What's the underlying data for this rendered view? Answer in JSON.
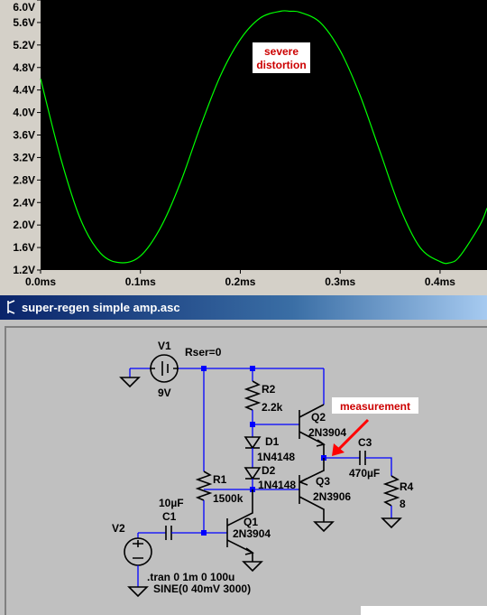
{
  "plot": {
    "y_ticks": [
      "6.0V",
      "5.6V",
      "5.2V",
      "4.8V",
      "4.4V",
      "4.0V",
      "3.6V",
      "3.2V",
      "2.8V",
      "2.4V",
      "2.0V",
      "1.6V",
      "1.2V"
    ],
    "x_ticks": [
      "0.0ms",
      "0.1ms",
      "0.2ms",
      "0.3ms",
      "0.4ms"
    ],
    "annotation": [
      "severe",
      "distortion"
    ],
    "colors": {
      "background": "#000000",
      "trace": "#00ff00",
      "annotation_text": "#cc0000"
    }
  },
  "chart_data": {
    "type": "line",
    "ylim": [
      1.2,
      6.0
    ],
    "xlim": [
      0.0,
      0.447
    ],
    "x_unit": "ms",
    "y_unit": "V",
    "x": [
      0.0,
      0.02,
      0.04,
      0.06,
      0.08,
      0.1,
      0.12,
      0.14,
      0.16,
      0.18,
      0.2,
      0.22,
      0.24,
      0.25,
      0.26,
      0.28,
      0.3,
      0.32,
      0.34,
      0.36,
      0.38,
      0.4,
      0.41,
      0.42,
      0.44,
      0.447
    ],
    "y": [
      4.6,
      3.2,
      2.1,
      1.5,
      1.33,
      1.45,
      1.95,
      2.75,
      3.75,
      4.65,
      5.3,
      5.68,
      5.8,
      5.8,
      5.78,
      5.6,
      5.1,
      4.3,
      3.3,
      2.3,
      1.6,
      1.35,
      1.33,
      1.45,
      2.0,
      2.3
    ]
  },
  "window": {
    "title": "super-regen simple amp.asc",
    "title_colors": {
      "start": "#0a246a",
      "end": "#a6caf0"
    }
  },
  "schematic": {
    "labels": {
      "v1": "V1",
      "v1_value": "9V",
      "rser": "Rser=0",
      "r2": "R2",
      "r2_value": "2.2k",
      "q2": "Q2",
      "q2_value": "2N3904",
      "measurement": "measurement",
      "d1": "D1",
      "d1_value": "1N4148",
      "d2": "D2",
      "d2_value": "1N4148",
      "q3": "Q3",
      "q3_value": "2N3906",
      "c3": "C3",
      "c3_value": "470µF",
      "r1": "R1",
      "r1_value": "1500k",
      "r4": "R4",
      "r4_value": "8",
      "c1_value": "10µF",
      "c1": "C1",
      "q1": "Q1",
      "q1_value": "2N3904",
      "v2": "V2",
      "tran": ".tran 0 1m 0 100u",
      "sine": "SINE(0 40mV 3000)"
    },
    "colors": {
      "wire": "#0000ff",
      "part": "#000000",
      "arrow": "#ff0000",
      "label_box": "#ffffff"
    }
  }
}
